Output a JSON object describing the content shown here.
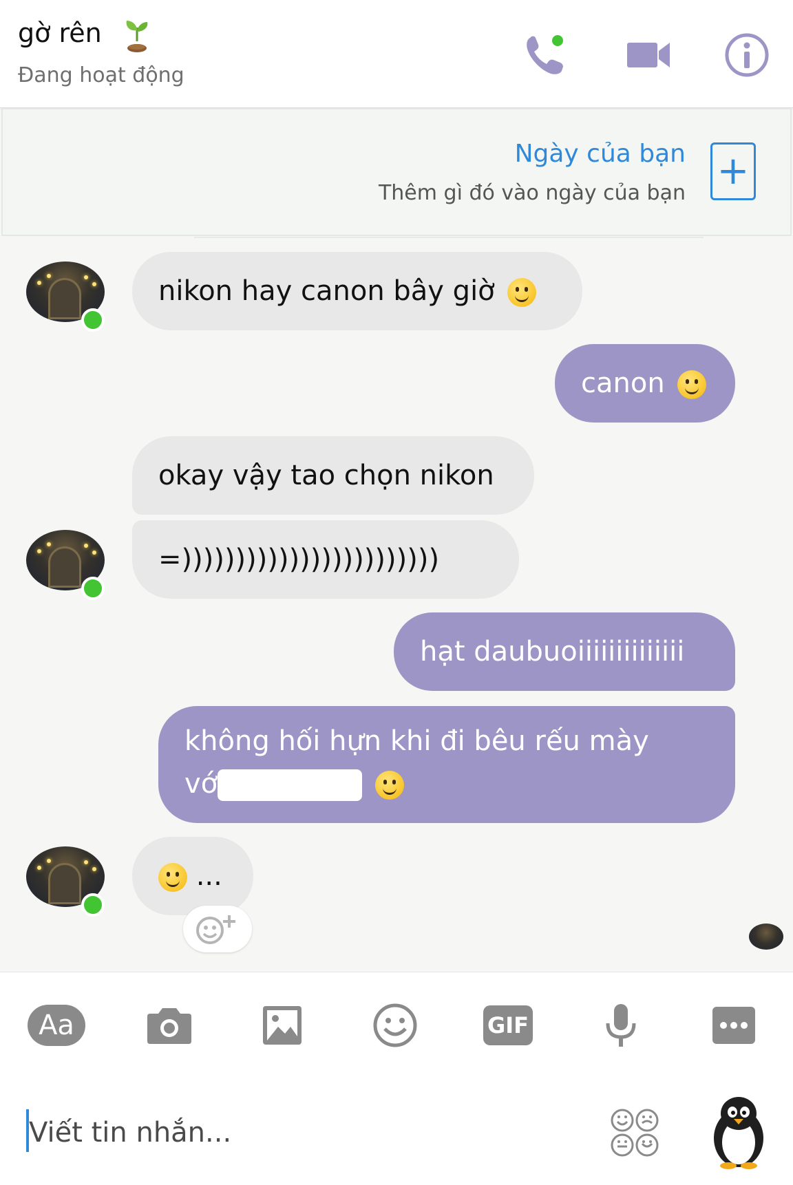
{
  "header": {
    "contact_name": "gờ rên",
    "status": "Đang hoạt động",
    "icons": [
      "plant-emoji",
      "phone-icon",
      "video-icon",
      "info-icon"
    ],
    "accent_color": "#9c95c6"
  },
  "your_day": {
    "title": "Ngày của bạn",
    "subtitle": "Thêm gì đó vào ngày của bạn",
    "add_symbol": "+"
  },
  "messages": [
    {
      "from": "them",
      "text": "nikon hay canon bây giờ",
      "emoji": "smiley"
    },
    {
      "from": "me",
      "text": "canon",
      "emoji": "smiley"
    },
    {
      "from": "them",
      "text": "okay vậy tao chọn nikon"
    },
    {
      "from": "them",
      "text": "=))))))))))))))))))))))))"
    },
    {
      "from": "me",
      "text": "hạt daubuoiiiiiiiiiiiiii"
    },
    {
      "from": "me",
      "text_line1": "không hối hựn khi đi bêu rếu mày",
      "text_line2_prefix": "vớ",
      "text_line2_suffix": "",
      "emoji": "smiley",
      "redacted": true
    },
    {
      "from": "them",
      "text": "...",
      "emoji": "smiley"
    }
  ],
  "reaction_button": {
    "icon": "add-reaction-icon",
    "symbol": "+"
  },
  "toolbar": {
    "text_format_label": "Aa",
    "gif_label": "GIF",
    "icons": [
      "camera-icon",
      "image-icon",
      "emoji-icon",
      "mic-icon",
      "more-icon"
    ]
  },
  "composer": {
    "placeholder": "Viết tin nhắn...",
    "value": ""
  },
  "colors": {
    "outgoing_bubble": "#9c95c6",
    "incoming_bubble": "#e8e8e8",
    "online_dot": "#42c433",
    "link_blue": "#2f89d8",
    "icon_gray": "#8a8a8a"
  }
}
